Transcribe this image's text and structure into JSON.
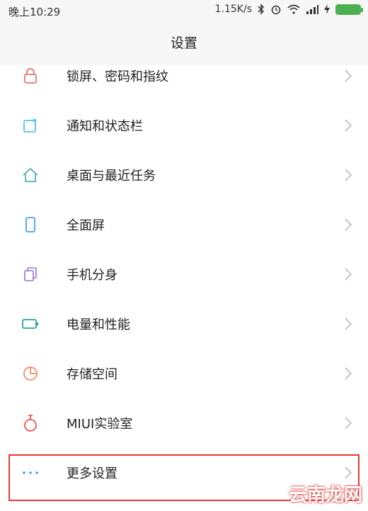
{
  "status": {
    "time": "晚上10:29",
    "speed": "1.15K/s",
    "icons": [
      "bluetooth-icon",
      "alarm-icon",
      "wifi-icon",
      "signal-icon",
      "charging-icon",
      "battery-icon"
    ]
  },
  "header": {
    "title": "设置"
  },
  "items": [
    {
      "label": "锁屏、密码和指纹",
      "icon": "lock-icon",
      "color": "#e57373"
    },
    {
      "label": "通知和状态栏",
      "icon": "notification-icon",
      "color": "#4fc3f7"
    },
    {
      "label": "桌面与最近任务",
      "icon": "home-icon",
      "color": "#4db6ac"
    },
    {
      "label": "全面屏",
      "icon": "phone-icon",
      "color": "#42a5f5"
    },
    {
      "label": "手机分身",
      "icon": "clone-icon",
      "color": "#9575cd"
    },
    {
      "label": "电量和性能",
      "icon": "battery-outline-icon",
      "color": "#26a69a"
    },
    {
      "label": "存储空间",
      "icon": "pie-chart-icon",
      "color": "#ff8a65"
    },
    {
      "label": "MIUI实验室",
      "icon": "flask-icon",
      "color": "#ef5350"
    },
    {
      "label": "更多设置",
      "icon": "more-icon",
      "color": "#42a5f5"
    }
  ],
  "watermark": "云南龙网"
}
